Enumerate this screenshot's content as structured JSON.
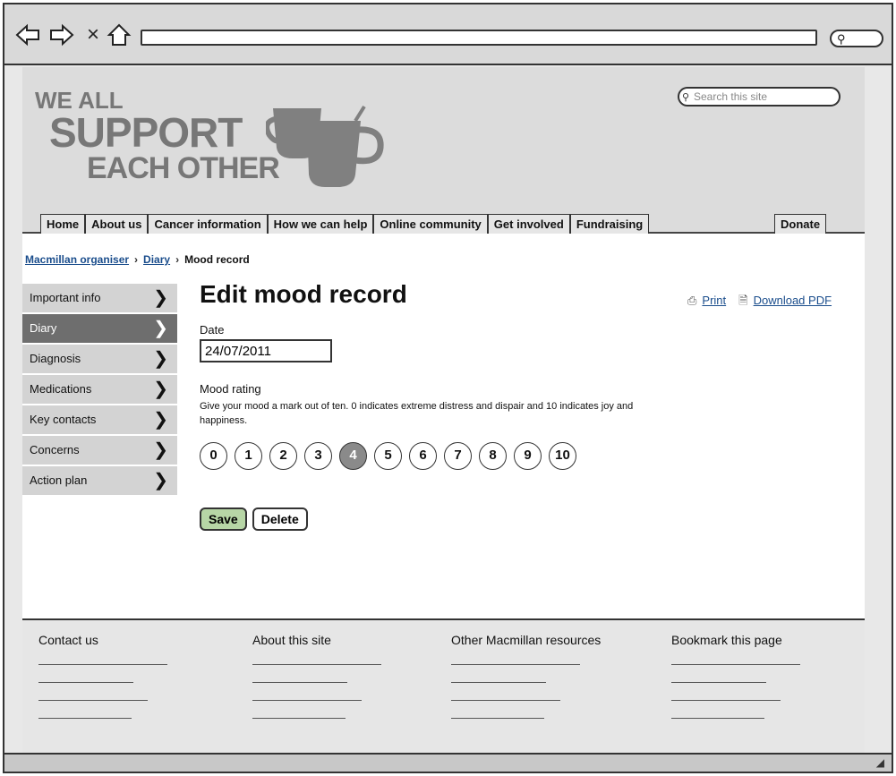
{
  "browser": {
    "back_icon": "arrow-left-icon",
    "forward_icon": "arrow-right-icon",
    "close_glyph": "×",
    "home_icon": "home-icon"
  },
  "site": {
    "logo_line1": "WE ALL",
    "logo_line2": "SUPPORT",
    "logo_line3": "EACH OTHER",
    "search_placeholder": "Search this site"
  },
  "nav": {
    "tabs": [
      "Home",
      "About us",
      "Cancer information",
      "How we can help",
      "Online community",
      "Get involved",
      "Fundraising"
    ],
    "donate": "Donate"
  },
  "breadcrumb": {
    "items": [
      "Macmillan organiser",
      "Diary"
    ],
    "current": "Mood record"
  },
  "sidebar": {
    "items": [
      {
        "label": "Important info",
        "active": false
      },
      {
        "label": "Diary",
        "active": true
      },
      {
        "label": "Diagnosis",
        "active": false
      },
      {
        "label": "Medications",
        "active": false
      },
      {
        "label": "Key contacts",
        "active": false
      },
      {
        "label": "Concerns",
        "active": false
      },
      {
        "label": "Action plan",
        "active": false
      }
    ]
  },
  "main": {
    "title": "Edit mood record",
    "print_label": "Print",
    "download_label": "Download PDF",
    "date_label": "Date",
    "date_value": "24/07/2011",
    "rating_label": "Mood rating",
    "rating_help": "Give your mood a mark out of ten. 0 indicates extreme distress and dispair and 10 indicates joy and happiness.",
    "rating_options": [
      "0",
      "1",
      "2",
      "3",
      "4",
      "5",
      "6",
      "7",
      "8",
      "9",
      "10"
    ],
    "rating_selected": "4",
    "save_label": "Save",
    "delete_label": "Delete"
  },
  "footer": {
    "columns": [
      "Contact us",
      "About this site",
      "Other Macmillan resources",
      "Bookmark this page"
    ]
  },
  "colors": {
    "link": "#1a4d8c",
    "save_button": "#b7d6a6",
    "active_sidebar": "#6e6e6e"
  }
}
